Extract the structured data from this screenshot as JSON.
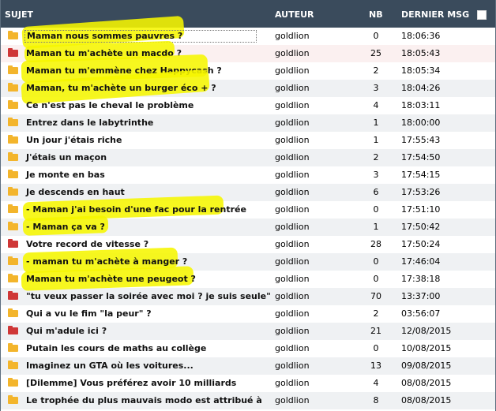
{
  "columns": {
    "subject": "SUJET",
    "author": "AUTEUR",
    "nb": "NB",
    "last": "DERNIER MSG"
  },
  "rows": [
    {
      "title": "Maman nous sommes pauvres ?",
      "author": "goldlion",
      "nb": "0",
      "time": "18:06:36",
      "icon": "yellow"
    },
    {
      "title": "Maman tu m'achète un macdo ?",
      "author": "goldlion",
      "nb": "25",
      "time": "18:05:43",
      "icon": "red"
    },
    {
      "title": "Maman tu m'emmène chez Happycash ?",
      "author": "goldlion",
      "nb": "2",
      "time": "18:05:34",
      "icon": "yellow"
    },
    {
      "title": "Maman, tu m'achète un burger éco + ?",
      "author": "goldlion",
      "nb": "3",
      "time": "18:04:26",
      "icon": "yellow"
    },
    {
      "title": "Ce n'est pas le cheval le problème",
      "author": "goldlion",
      "nb": "4",
      "time": "18:03:11",
      "icon": "yellow"
    },
    {
      "title": "Entrez dans le labytrinthe",
      "author": "goldlion",
      "nb": "1",
      "time": "18:00:00",
      "icon": "yellow"
    },
    {
      "title": "Un jour j'étais riche",
      "author": "goldlion",
      "nb": "1",
      "time": "17:55:43",
      "icon": "yellow"
    },
    {
      "title": "J'étais un maçon",
      "author": "goldlion",
      "nb": "2",
      "time": "17:54:50",
      "icon": "yellow"
    },
    {
      "title": "Je monte en bas",
      "author": "goldlion",
      "nb": "3",
      "time": "17:54:15",
      "icon": "yellow"
    },
    {
      "title": "Je descends en haut",
      "author": "goldlion",
      "nb": "6",
      "time": "17:53:26",
      "icon": "yellow"
    },
    {
      "title": "- Maman j'ai besoin d'une fac pour la rentrée",
      "author": "goldlion",
      "nb": "0",
      "time": "17:51:10",
      "icon": "yellow"
    },
    {
      "title": "- Maman ça va ?",
      "author": "goldlion",
      "nb": "1",
      "time": "17:50:42",
      "icon": "yellow"
    },
    {
      "title": "Votre record de vitesse ?",
      "author": "goldlion",
      "nb": "28",
      "time": "17:50:24",
      "icon": "red"
    },
    {
      "title": "- maman tu m'achète à manger ?",
      "author": "goldlion",
      "nb": "0",
      "time": "17:46:04",
      "icon": "yellow"
    },
    {
      "title": "Maman tu m'achète une peugeot ?",
      "author": "goldlion",
      "nb": "0",
      "time": "17:38:18",
      "icon": "yellow"
    },
    {
      "title": "\"tu veux passer la soirée avec moi ? je suis seule\"",
      "author": "goldlion",
      "nb": "70",
      "time": "13:37:00",
      "icon": "red"
    },
    {
      "title": "Qui a vu le fim \"la peur\" ?",
      "author": "goldlion",
      "nb": "2",
      "time": "03:56:07",
      "icon": "yellow"
    },
    {
      "title": "Qui m'adule ici ?",
      "author": "goldlion",
      "nb": "21",
      "time": "12/08/2015",
      "icon": "red"
    },
    {
      "title": "Putain les cours de maths au collège",
      "author": "goldlion",
      "nb": "0",
      "time": "10/08/2015",
      "icon": "yellow"
    },
    {
      "title": "Imaginez un GTA où les voitures...",
      "author": "goldlion",
      "nb": "13",
      "time": "09/08/2015",
      "icon": "yellow"
    },
    {
      "title": "[Dilemme] Vous préférez avoir 10 milliards",
      "author": "goldlion",
      "nb": "4",
      "time": "08/08/2015",
      "icon": "yellow"
    },
    {
      "title": "Le trophée du plus mauvais modo est attribué à",
      "author": "goldlion",
      "nb": "8",
      "time": "08/08/2015",
      "icon": "yellow"
    }
  ]
}
